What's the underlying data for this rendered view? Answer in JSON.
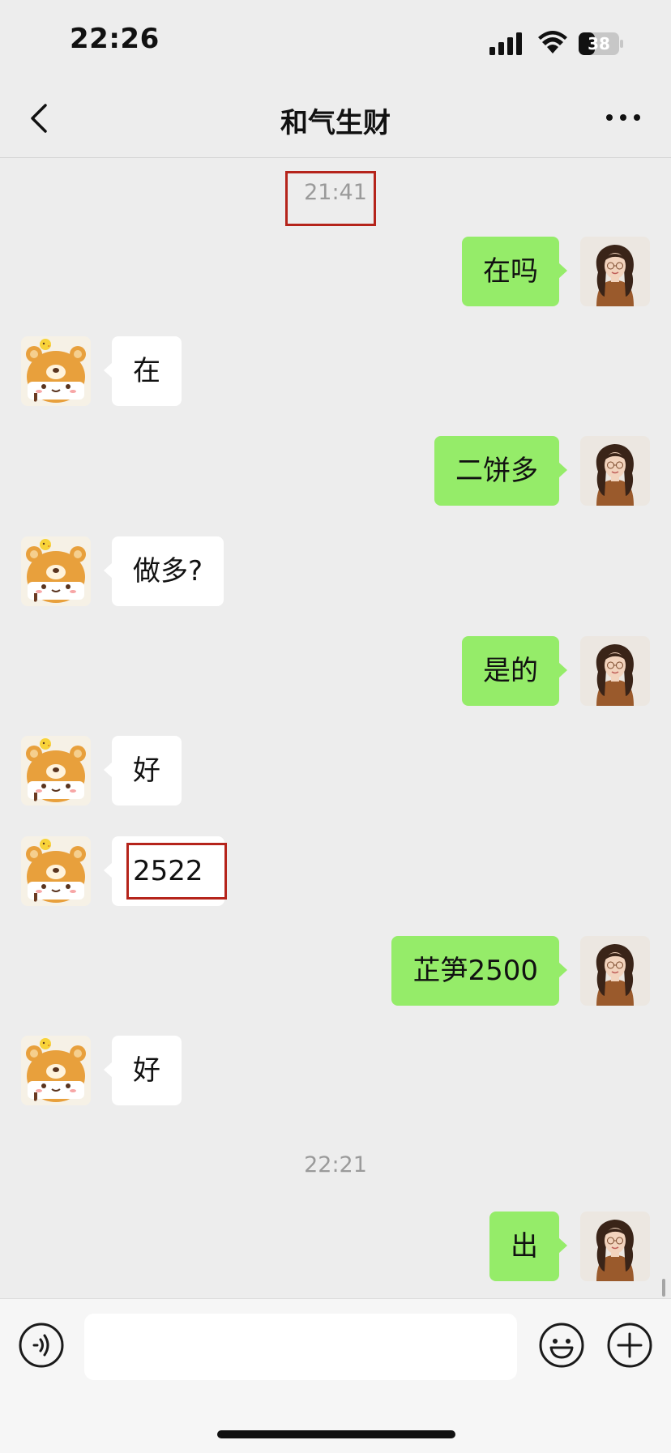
{
  "status_bar": {
    "time": "22:26",
    "battery_level": "38",
    "icons": [
      "signal-icon",
      "wifi-icon",
      "battery-icon"
    ]
  },
  "nav": {
    "title": "和气生财",
    "left_icon": "chevron-left-icon",
    "right_icon": "more-dots-icon"
  },
  "chat": {
    "timestamps": [
      "21:41",
      "22:21"
    ],
    "messages": [
      {
        "side": "out",
        "text": "在吗"
      },
      {
        "side": "in",
        "text": "在"
      },
      {
        "side": "out",
        "text": "二饼多"
      },
      {
        "side": "in",
        "text": "做多?"
      },
      {
        "side": "out",
        "text": "是的"
      },
      {
        "side": "in",
        "text": "好"
      },
      {
        "side": "in",
        "text": "2522"
      },
      {
        "side": "out",
        "text": "芷笋2500"
      },
      {
        "side": "in",
        "text": "好"
      },
      {
        "side": "out",
        "text": "出"
      }
    ],
    "avatars": {
      "self": "woman-portrait-avatar",
      "contact": "bear-cartoon-avatar"
    }
  },
  "input_bar": {
    "placeholder": "",
    "left_icon": "voice-icon",
    "right_icons": [
      "emoji-icon",
      "plus-icon"
    ]
  },
  "colors": {
    "outgoing_bubble": "#95ec69",
    "incoming_bubble": "#ffffff",
    "background": "#ededed",
    "highlight": "#b5241b"
  }
}
